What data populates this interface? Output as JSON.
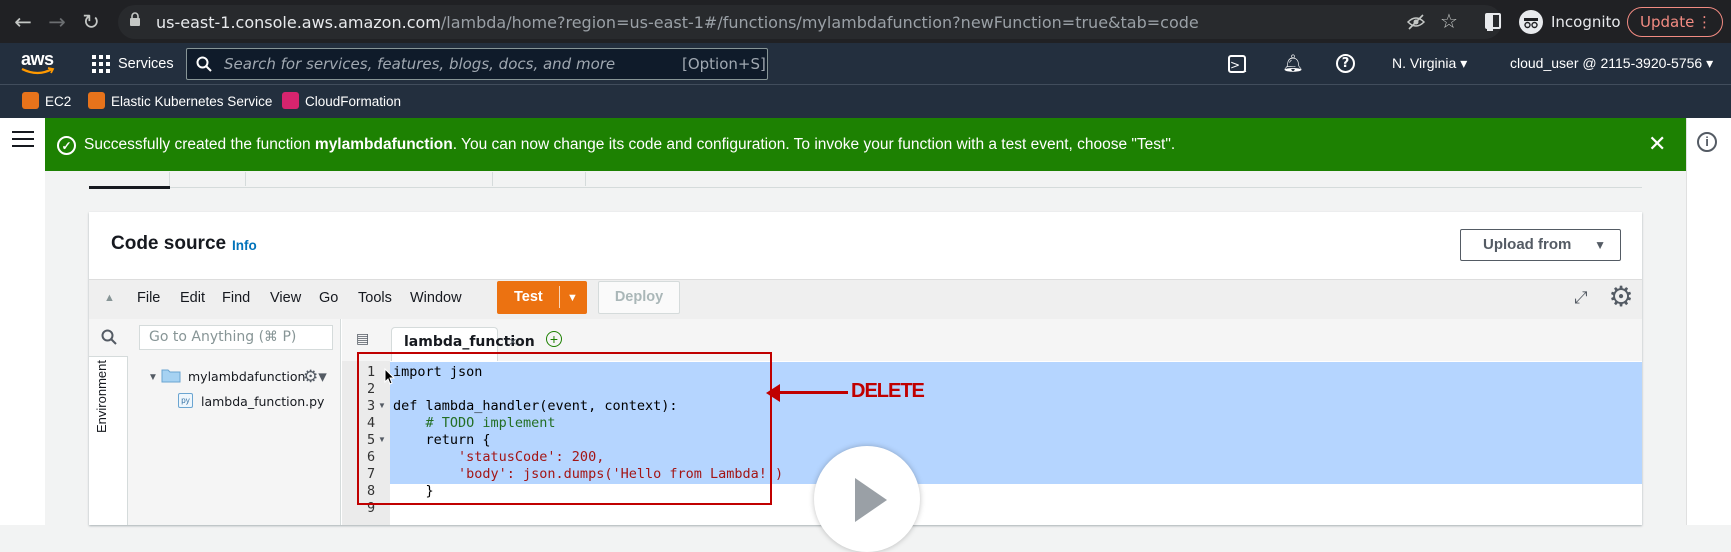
{
  "browser": {
    "url_host": "us-east-1.console.aws.amazon.com",
    "url_path": "/lambda/home?region=us-east-1#/functions/mylambdafunction?newFunction=true&tab=code",
    "incognito_label": "Incognito",
    "update_label": "Update"
  },
  "aws_nav": {
    "logo": "aws",
    "services_label": "Services",
    "search_placeholder": "Search for services, features, blogs, docs, and more",
    "search_shortcut": "[Option+S]",
    "region": "N. Virginia ▾",
    "account": "cloud_user @ 2115-3920-5756 ▾"
  },
  "favorites": [
    {
      "label": "EC2",
      "color": "#e7731b"
    },
    {
      "label": "Elastic Kubernetes Service",
      "color": "#e7731b"
    },
    {
      "label": "CloudFormation",
      "color": "#d6246e"
    }
  ],
  "flash": {
    "prefix": "Successfully created the function ",
    "function_name": "mylambdafunction",
    "suffix": ". You can now change its code and configuration. To invoke your function with a test event, choose \"Test\".",
    "color": "#1d8102"
  },
  "code_source": {
    "title": "Code source",
    "info": "Info",
    "upload_label": "Upload from"
  },
  "ide": {
    "menu": [
      "File",
      "Edit",
      "Find",
      "View",
      "Go",
      "Tools",
      "Window"
    ],
    "test_label": "Test",
    "deploy_label": "Deploy",
    "goto_placeholder": "Go to Anything (⌘ P)",
    "environment_tab": "Environment",
    "folder_name": "mylambdafunction",
    "file_name": "lambda_function.py",
    "editor_tab": "lambda_function",
    "line_numbers": [
      "1",
      "2",
      "3",
      "4",
      "5",
      "6",
      "7",
      "8",
      "9"
    ],
    "code_lines": [
      "import json",
      "",
      "def lambda_handler(event, context):",
      "    # TODO implement",
      "    return {",
      "        'statusCode': 200,",
      "        'body': json.dumps('Hello from Lambda!')",
      "    }",
      ""
    ]
  },
  "annotation": {
    "label": "DELETE",
    "color": "#c00000"
  }
}
